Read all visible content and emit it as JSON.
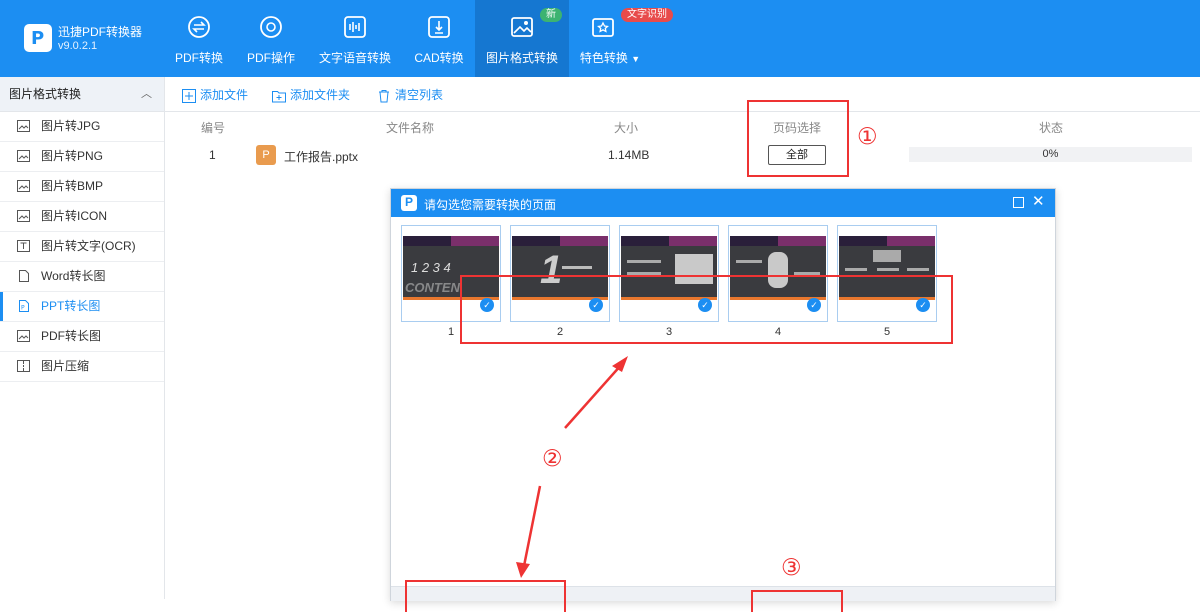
{
  "app": {
    "name": "迅捷PDF转换器",
    "version": "v9.0.2.1"
  },
  "nav": [
    {
      "label": "PDF转换",
      "icon": "pdf-convert-icon"
    },
    {
      "label": "PDF操作",
      "icon": "pdf-operate-icon"
    },
    {
      "label": "文字语音转换",
      "icon": "voice-icon"
    },
    {
      "label": "CAD转换",
      "icon": "cad-icon"
    },
    {
      "label": "图片格式转换",
      "icon": "image-icon",
      "badge": "新",
      "active": true
    },
    {
      "label": "特色转换",
      "icon": "special-icon",
      "badge": "文字识别"
    }
  ],
  "colors": {
    "brand": "#1c8ef2",
    "badge_new": "#3cb371",
    "badge_ocr": "#e84b4b",
    "annotation": "#e33333"
  },
  "sidebar": {
    "header": "图片格式转换",
    "items": [
      {
        "label": "图片转JPG"
      },
      {
        "label": "图片转PNG"
      },
      {
        "label": "图片转BMP"
      },
      {
        "label": "图片转ICON"
      },
      {
        "label": "图片转文字(OCR)"
      },
      {
        "label": "Word转长图"
      },
      {
        "label": "PPT转长图",
        "active": true
      },
      {
        "label": "PDF转长图"
      },
      {
        "label": "图片压缩"
      }
    ]
  },
  "toolbar": {
    "add_file": "添加文件",
    "add_folder": "添加文件夹",
    "clear_list": "清空列表"
  },
  "table": {
    "headers": {
      "index": "编号",
      "name": "文件名称",
      "size": "大小",
      "page_select": "页码选择",
      "status": "状态"
    },
    "row": {
      "index": "1",
      "icon_letter": "P",
      "name": "工作报告.pptx",
      "size": "1.14MB",
      "page_button": "全部",
      "progress_text": "0%",
      "progress": 0
    }
  },
  "dialog": {
    "title": "请勾选您需要转换的页面",
    "icon_letter": "P",
    "pages": [
      {
        "number": "1",
        "checked": true
      },
      {
        "number": "2",
        "checked": true
      },
      {
        "number": "3",
        "checked": true
      },
      {
        "number": "4",
        "checked": true
      },
      {
        "number": "5",
        "checked": true
      }
    ]
  },
  "annotations": {
    "one": "①",
    "two": "②",
    "three": "③"
  },
  "logo_letter": "P"
}
